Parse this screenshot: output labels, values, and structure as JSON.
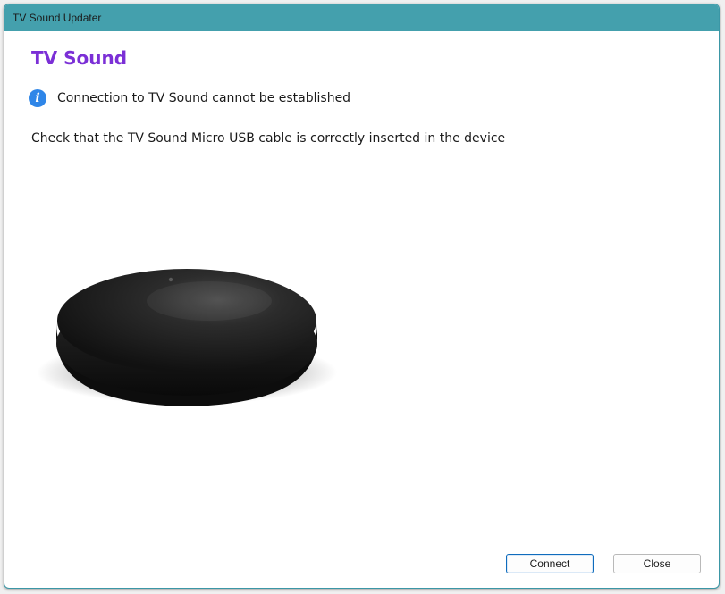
{
  "window": {
    "title": "TV Sound Updater"
  },
  "header": {
    "app_title": "TV Sound"
  },
  "status": {
    "icon": "info-icon",
    "icon_glyph": "i",
    "message": "Connection to TV Sound cannot be established"
  },
  "instructions": {
    "text": "Check that the TV Sound Micro USB cable is correctly inserted in the device"
  },
  "buttons": {
    "connect_label": "Connect",
    "close_label": "Close"
  },
  "colors": {
    "titlebar": "#44a0ad",
    "app_title": "#7b2fd6",
    "info_icon": "#2f86e8",
    "primary_button_border": "#0f6cbd"
  }
}
